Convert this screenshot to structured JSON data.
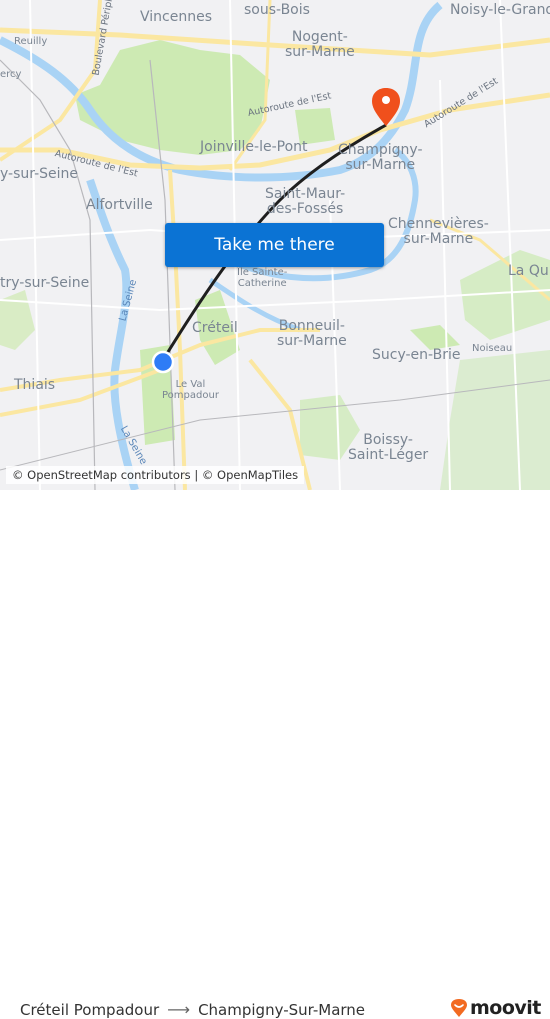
{
  "map": {
    "labels": {
      "vincennes": "Vincennes",
      "sous_bois": "sous-Bois",
      "noisy": "Noisy-le-Grand",
      "reuilly": "Reuilly",
      "bercy": "ercy",
      "boulevard": "Boulevard Périph",
      "nogent": "Nogent-\nsur-Marne",
      "joinville": "Joinville-le-Pont",
      "ivry": "y-sur-Seine",
      "alfortville": "Alfortville",
      "champigny": "Champigny-\nsur-Marne",
      "saint_maur": "Saint-Maur-\ndes-Fossés",
      "chennevieres": "Chennevières-\nsur-Marne",
      "ile_sainte": "Île Sainte-\nCatherine",
      "vitry": "try-sur-Seine",
      "la_queue": "La Qu",
      "creteil": "Créteil",
      "bonneuil": "Bonneuil-\nsur-Marne",
      "sucy": "Sucy-en-Brie",
      "noiseau": "Noiseau",
      "thiais": "Thiais",
      "le_val": "Le Val\nPompadour",
      "boissy": "Boissy-\nSaint-Léger"
    },
    "roads": {
      "autoroute_est_1": "Autoroute de l'Est",
      "autoroute_est_2": "Autoroute de l'Est",
      "autoroute_est_3": "Autoroute de l'Est"
    },
    "water": {
      "la_seine_1": "La Seine",
      "la_seine_2": "La Seine"
    },
    "colors": {
      "origin_marker": "#2e7cf6",
      "destination_marker": "#f0501c",
      "route_line": "#1f1f1f"
    },
    "icons": {
      "origin": "origin-dot-icon",
      "destination": "destination-pin-icon"
    }
  },
  "cta": {
    "label": "Take me there",
    "color": "#0b73d4"
  },
  "attribution": "© OpenStreetMap contributors | © OpenMapTiles",
  "footer": {
    "origin": "Créteil Pompadour",
    "arrow": "⟶",
    "destination": "Champigny-Sur-Marne",
    "brand": "moovit",
    "brand_color": "#f26a21"
  }
}
